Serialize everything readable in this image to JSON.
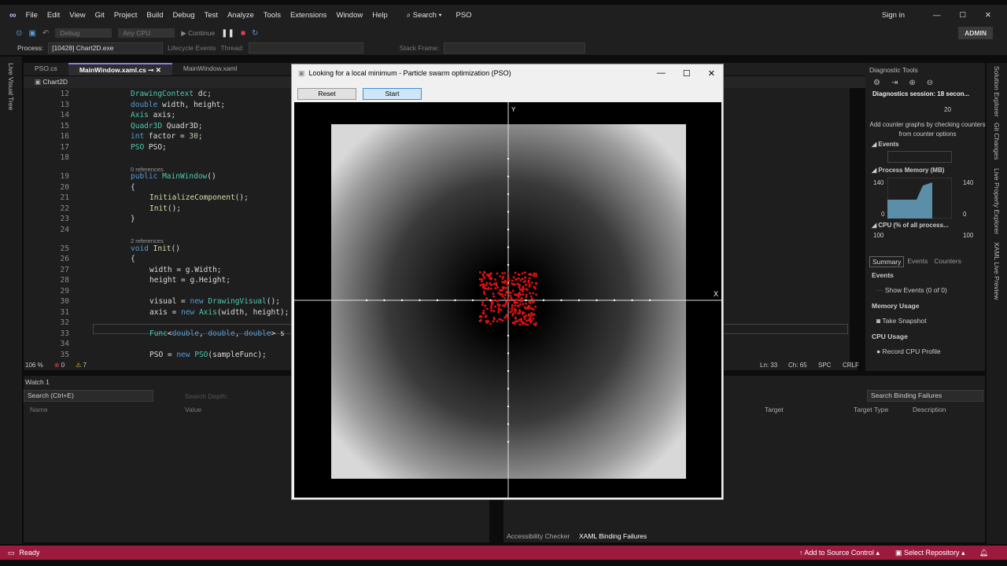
{
  "menu": {
    "items": [
      "File",
      "Edit",
      "View",
      "Git",
      "Project",
      "Build",
      "Debug",
      "Test",
      "Analyze",
      "Tools",
      "Extensions",
      "Window",
      "Help"
    ],
    "search": "Search",
    "solution": "PSO",
    "sign_in": "Sign in",
    "admin": "ADMIN"
  },
  "toolbar": {
    "config": "Debug",
    "platform": "Any CPU",
    "continue": "Continue"
  },
  "procbar": {
    "process_label": "Process:",
    "process_value": "[10428] Chart2D.exe",
    "lifecycle": "Lifecycle Events",
    "thread_label": "Thread:",
    "stack_label": "Stack Frame:"
  },
  "left_strip": {
    "label": "Live Visual Tree"
  },
  "tabs": [
    "PSO.cs",
    "MainWindow.xaml.cs",
    "MainWindow.xaml"
  ],
  "navbar": {
    "project": "Chart2D"
  },
  "code": [
    {
      "n": "12",
      "t": [
        [
          "DrawingContext",
          "ty"
        ],
        [
          " dc;",
          "id"
        ]
      ],
      "i": 0
    },
    {
      "n": "13",
      "t": [
        [
          "double",
          "kw"
        ],
        [
          " width, height;",
          "id"
        ]
      ],
      "i": 0
    },
    {
      "n": "14",
      "t": [
        [
          "Axis",
          "ty"
        ],
        [
          " axis;",
          "id"
        ]
      ],
      "i": 0
    },
    {
      "n": "15",
      "t": [
        [
          "Quadr3D",
          "ty"
        ],
        [
          " Quadr3D;",
          "id"
        ]
      ],
      "i": 0
    },
    {
      "n": "16",
      "t": [
        [
          "int",
          "kw"
        ],
        [
          " factor = ",
          "id"
        ],
        [
          "30",
          "num"
        ],
        [
          ";",
          "id"
        ]
      ],
      "i": 0
    },
    {
      "n": "17",
      "t": [
        [
          "PSO",
          "ty"
        ],
        [
          " PSO;",
          "id"
        ]
      ],
      "i": 0
    },
    {
      "n": "18",
      "t": [],
      "i": 0
    },
    {
      "lens": "0 references"
    },
    {
      "n": "19",
      "t": [
        [
          "public",
          "kw"
        ],
        [
          " ",
          "id"
        ],
        [
          "MainWindow",
          "ty"
        ],
        [
          "()",
          "id"
        ]
      ],
      "i": 0
    },
    {
      "n": "20",
      "t": [
        [
          "{",
          "id"
        ]
      ],
      "i": 0
    },
    {
      "n": "21",
      "t": [
        [
          "InitializeComponent",
          "fn"
        ],
        [
          "();",
          "id"
        ]
      ],
      "i": 1
    },
    {
      "n": "22",
      "t": [
        [
          "Init",
          "fn"
        ],
        [
          "();",
          "id"
        ]
      ],
      "i": 1
    },
    {
      "n": "23",
      "t": [
        [
          "}",
          "id"
        ]
      ],
      "i": 0
    },
    {
      "n": "24",
      "t": [],
      "i": 0
    },
    {
      "lens": "2 references"
    },
    {
      "n": "25",
      "t": [
        [
          "void",
          "kw"
        ],
        [
          " ",
          "id"
        ],
        [
          "Init",
          "fn"
        ],
        [
          "()",
          "id"
        ]
      ],
      "i": 0
    },
    {
      "n": "26",
      "t": [
        [
          "{",
          "id"
        ]
      ],
      "i": 0
    },
    {
      "n": "27",
      "t": [
        [
          "width = g.Width;",
          "id"
        ]
      ],
      "i": 1
    },
    {
      "n": "28",
      "t": [
        [
          "height = g.Height;",
          "id"
        ]
      ],
      "i": 1
    },
    {
      "n": "29",
      "t": [],
      "i": 1
    },
    {
      "n": "30",
      "t": [
        [
          "visual = ",
          "id"
        ],
        [
          "new",
          "kw"
        ],
        [
          " ",
          "id"
        ],
        [
          "DrawingVisual",
          "ty"
        ],
        [
          "();",
          "id"
        ]
      ],
      "i": 1
    },
    {
      "n": "31",
      "t": [
        [
          "axis = ",
          "id"
        ],
        [
          "new",
          "kw"
        ],
        [
          " ",
          "id"
        ],
        [
          "Axis",
          "ty"
        ],
        [
          "(width, height);",
          "id"
        ]
      ],
      "i": 1
    },
    {
      "n": "32",
      "t": [],
      "i": 1
    },
    {
      "n": "33",
      "t": [
        [
          "Func",
          "ty"
        ],
        [
          "<",
          "id"
        ],
        [
          "double",
          "kw"
        ],
        [
          ", ",
          "id"
        ],
        [
          "double",
          "kw"
        ],
        [
          ", ",
          "id"
        ],
        [
          "double",
          "kw"
        ],
        [
          "> s",
          "id"
        ]
      ],
      "i": 1
    },
    {
      "n": "34",
      "t": [],
      "i": 1
    },
    {
      "n": "35",
      "t": [
        [
          "PSO = ",
          "id"
        ],
        [
          "new",
          "kw"
        ],
        [
          " ",
          "id"
        ],
        [
          "PSO",
          "ty"
        ],
        [
          "(sampleFunc);",
          "id"
        ]
      ],
      "i": 1
    }
  ],
  "editor_status": {
    "zoom": "106 %",
    "errors": "0",
    "warnings": "7",
    "line": "Ln: 33",
    "col": "Ch: 65",
    "spc": "SPC",
    "eol": "CRLF"
  },
  "watch": {
    "title": "Watch 1",
    "search_placeholder": "Search (Ctrl+E)",
    "depth_label": "Search Depth:",
    "columns": [
      "Name",
      "Value"
    ]
  },
  "binding": {
    "search_placeholder": "Search Binding Failures",
    "columns": [
      "Target",
      "Target Type",
      "Description"
    ],
    "tabs": [
      "Accessibility Checker",
      "XAML Binding Failures"
    ]
  },
  "diag": {
    "title": "Diagnostic Tools",
    "session": "Diagnostics session: 18 secon...",
    "timeline_tick": "20",
    "hint": "Add counter graphs by checking counters from counter options",
    "events": "Events",
    "memory": "Process Memory (MB)",
    "mem_max": "140",
    "mem_min": "0",
    "cpu": "CPU (% of all process...",
    "cpu_max": "100",
    "tabs": [
      "Summary",
      "Events",
      "Counters"
    ],
    "sections": [
      {
        "title": "Events",
        "action": "Show Events (0 of 0)"
      },
      {
        "title": "Memory Usage",
        "action": "Take Snapshot"
      },
      {
        "title": "CPU Usage",
        "action": "Record CPU Profile"
      }
    ]
  },
  "right_strip": [
    "Solution Explorer",
    "Git Changes",
    "Live Property Explorer",
    "XAML Live Preview"
  ],
  "status": {
    "ready": "Ready",
    "source_control": "Add to Source Control",
    "repo": "Select Repository"
  },
  "dialog": {
    "title": "Looking for a local minimum - Particle swarm optimization (PSO)",
    "reset": "Reset",
    "start": "Start",
    "axis_x": "X",
    "axis_y": "Y",
    "particle_color": "#e01010"
  },
  "colors": {
    "status_bar": "#9c1a3e",
    "accent": "#8c7ae6"
  }
}
